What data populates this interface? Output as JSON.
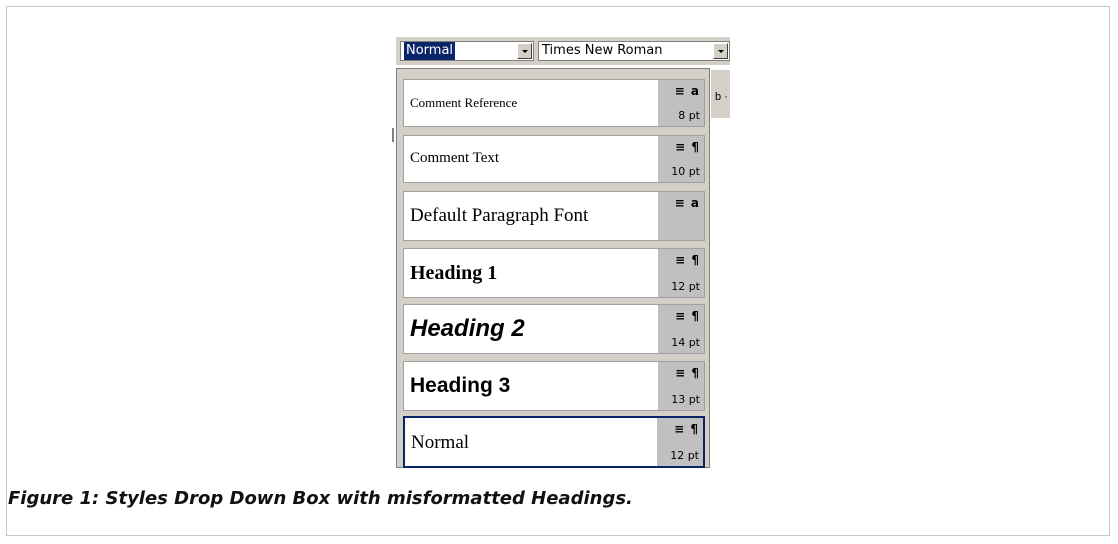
{
  "toolbar": {
    "style_value": "Normal",
    "font_value": "Times New Roman"
  },
  "styles": [
    {
      "label": "Comment Reference",
      "icons": "≡ a",
      "size": "8 pt"
    },
    {
      "label": "Comment Text",
      "icons": "≡ ¶",
      "size": "10 pt"
    },
    {
      "label": "Default Paragraph Font",
      "icons": "≡ a",
      "size": ""
    },
    {
      "label": "Heading 1",
      "icons": "≡ ¶",
      "size": "12 pt"
    },
    {
      "label": "Heading 2",
      "icons": "≡ ¶",
      "size": "14 pt"
    },
    {
      "label": "Heading 3",
      "icons": "≡ ¶",
      "size": "13 pt"
    },
    {
      "label": "Normal",
      "icons": "≡ ¶",
      "size": "12 pt"
    }
  ],
  "caption": "Figure 1: Styles Drop Down Box with misformatted Headings."
}
